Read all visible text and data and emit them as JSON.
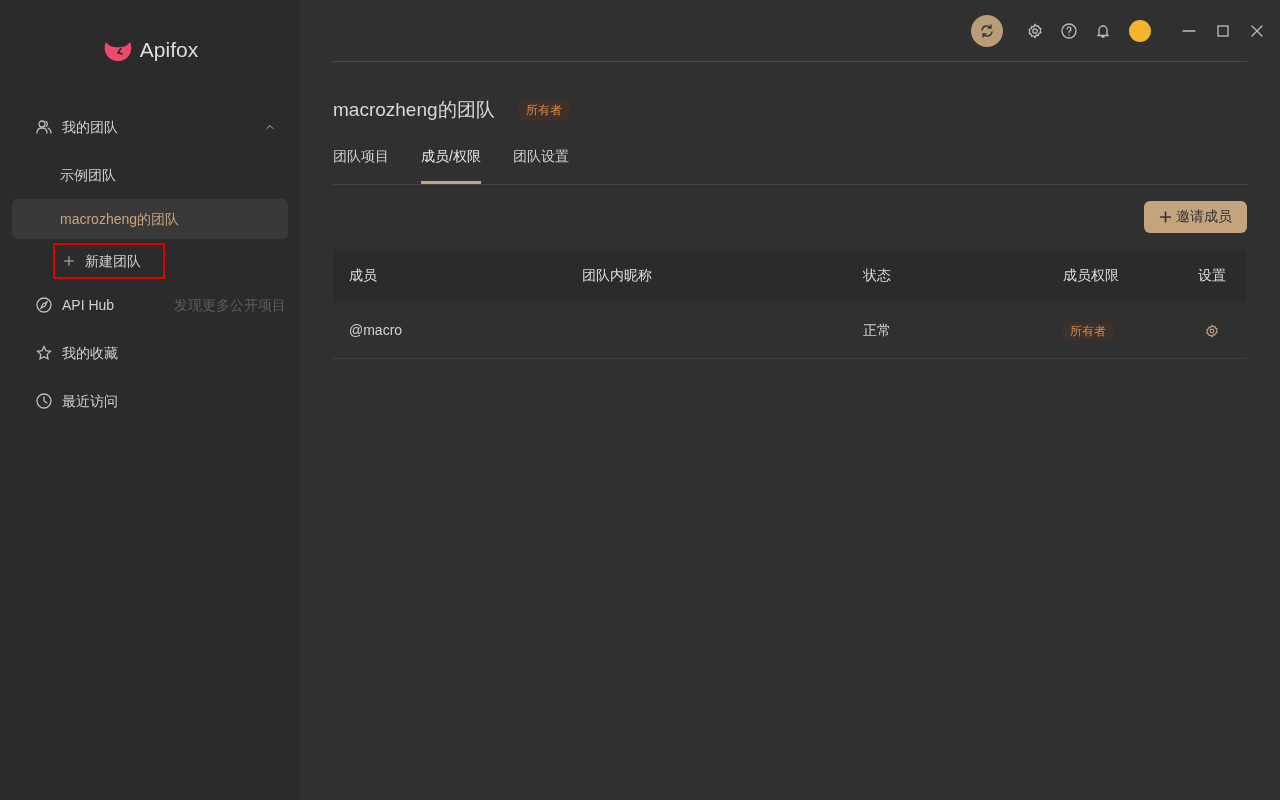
{
  "sidebar": {
    "logo": "Apifox",
    "items": [
      {
        "kind": "team",
        "label": "我的团队",
        "expanded": true,
        "children": [
          {
            "label": "示例团队",
            "selected": false
          },
          {
            "label": "macrozheng的团队",
            "selected": true
          }
        ],
        "action": {
          "label": "新建团队",
          "highlighted": true
        }
      },
      {
        "kind": "compass",
        "label": "API Hub",
        "hint": "发现更多公开项目"
      },
      {
        "kind": "star",
        "label": "我的收藏"
      },
      {
        "kind": "clock",
        "label": "最近访问"
      }
    ]
  },
  "team": {
    "title": "macrozheng的团队",
    "role": "所有者"
  },
  "tabs": [
    {
      "label": "团队项目",
      "selected": false
    },
    {
      "label": "成员/权限",
      "selected": true
    },
    {
      "label": "团队设置",
      "selected": false
    }
  ],
  "invite_button": {
    "label": "邀请成员"
  },
  "table": {
    "columns": [
      "成员",
      "团队内昵称",
      "状态",
      "成员权限",
      "设置"
    ],
    "rows": [
      {
        "member": "@macro",
        "status": "正常",
        "role": "所有者"
      }
    ]
  }
}
